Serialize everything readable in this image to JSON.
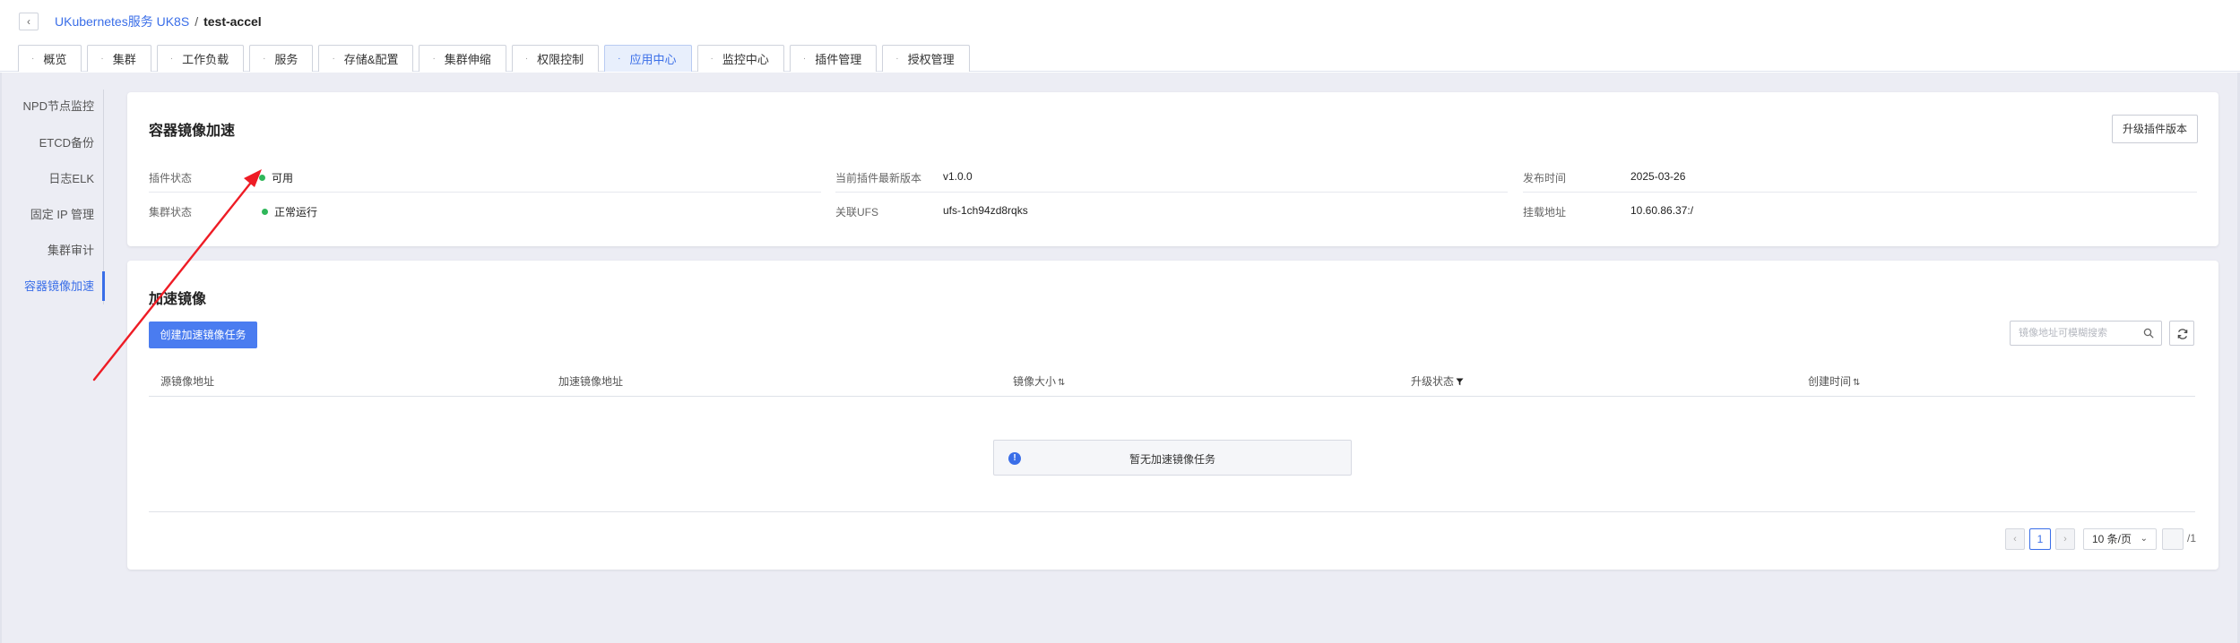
{
  "breadcrumb": {
    "back_icon": "chevron-left-icon",
    "service": "UKubernetes服务 UK8S",
    "separator": "/",
    "cluster": "test-accel"
  },
  "tabs": [
    {
      "label": "概览",
      "active": false
    },
    {
      "label": "集群",
      "active": false
    },
    {
      "label": "工作负载",
      "active": false
    },
    {
      "label": "服务",
      "active": false
    },
    {
      "label": "存储&配置",
      "active": false
    },
    {
      "label": "集群伸缩",
      "active": false
    },
    {
      "label": "权限控制",
      "active": false
    },
    {
      "label": "应用中心",
      "active": true
    },
    {
      "label": "监控中心",
      "active": false
    },
    {
      "label": "插件管理",
      "active": false
    },
    {
      "label": "授权管理",
      "active": false
    }
  ],
  "sidebar": {
    "items": [
      {
        "label": "NPD节点监控",
        "active": false
      },
      {
        "label": "ETCD备份",
        "active": false
      },
      {
        "label": "日志ELK",
        "active": false
      },
      {
        "label": "固定 IP 管理",
        "active": false
      },
      {
        "label": "集群审计",
        "active": false
      },
      {
        "label": "容器镜像加速",
        "active": true
      }
    ]
  },
  "plugin_card": {
    "title": "容器镜像加速",
    "upgrade_label": "升级插件版本",
    "fields": [
      {
        "label": "插件状态",
        "value": "可用",
        "status_color": "#2fb75a"
      },
      {
        "label": "集群状态",
        "value": "正常运行",
        "status_color": "#2fb75a"
      },
      {
        "label": "当前插件最新版本",
        "value": "v1.0.0"
      },
      {
        "label": "关联UFS",
        "value": "ufs-1ch94zd8rqks"
      },
      {
        "label": "发布时间",
        "value": "2025-03-26"
      },
      {
        "label": "挂载地址",
        "value": "10.60.86.37:/"
      }
    ]
  },
  "images_card": {
    "title": "加速镜像",
    "create_label": "创建加速镜像任务",
    "search_placeholder": "镜像地址可模糊搜索",
    "columns": [
      {
        "label": "源镜像地址"
      },
      {
        "label": "加速镜像地址"
      },
      {
        "label": "镜像大小",
        "icon": "sort-icon"
      },
      {
        "label": "升级状态",
        "icon": "filter-icon"
      },
      {
        "label": "创建时间",
        "icon": "sort-icon"
      }
    ],
    "empty_text": "暂无加速镜像任务",
    "pagination": {
      "prev": "‹",
      "current_page": "1",
      "next": "›",
      "page_size": "10 条/页",
      "total": "/1"
    }
  },
  "colors": {
    "accent": "#3a6ee8",
    "primary_button": "#4a7cf0",
    "status_ok": "#2fb75a",
    "arrow": "#ee1c25",
    "background": "#ecedf4"
  }
}
